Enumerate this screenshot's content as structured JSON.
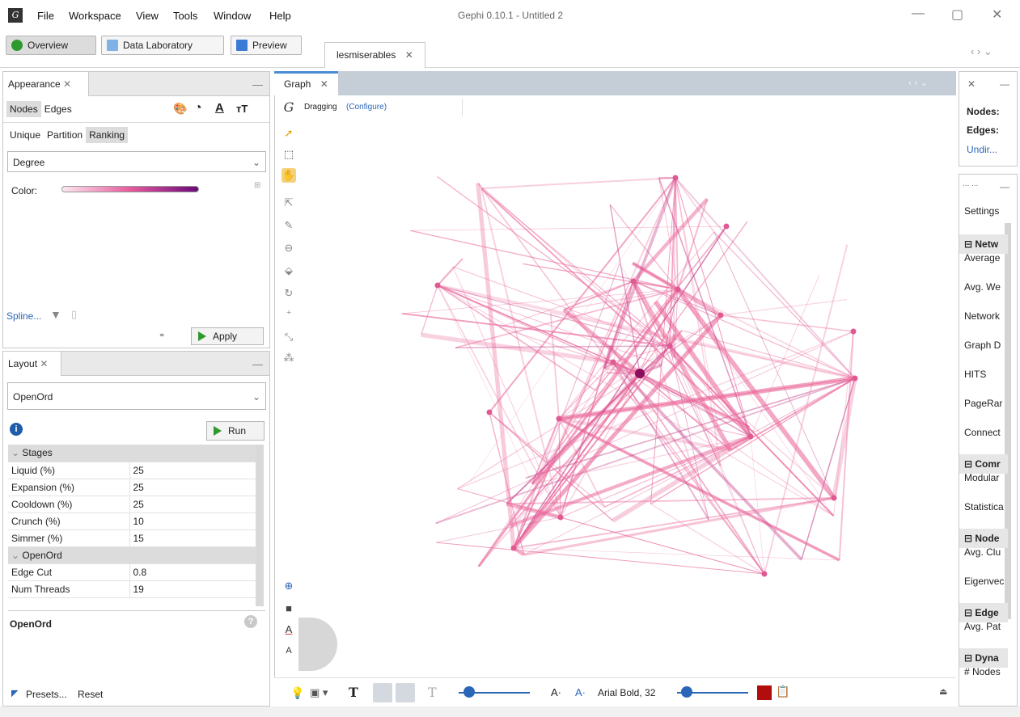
{
  "window": {
    "title": "Gephi 0.10.1 - Untitled 2"
  },
  "menu": [
    "File",
    "Workspace",
    "View",
    "Tools",
    "Window",
    "Help"
  ],
  "perspectives": {
    "overview": "Overview",
    "data_lab": "Data Laboratory",
    "preview": "Preview"
  },
  "workspace_tab": "lesmiserables",
  "appearance": {
    "tab": "Appearance",
    "element_tabs": [
      "Nodes",
      "Edges"
    ],
    "mode_tabs": [
      "Unique",
      "Partition",
      "Ranking"
    ],
    "attribute": "Degree",
    "color_label": "Color:",
    "spline_label": "Spline...",
    "apply_label": "Apply"
  },
  "layout": {
    "tab": "Layout",
    "algorithm": "OpenOrd",
    "run_label": "Run",
    "groups": [
      {
        "name": "Stages",
        "rows": [
          {
            "k": "Liquid (%)",
            "v": "25"
          },
          {
            "k": "Expansion (%)",
            "v": "25"
          },
          {
            "k": "Cooldown (%)",
            "v": "25"
          },
          {
            "k": "Crunch (%)",
            "v": "10"
          },
          {
            "k": "Simmer (%)",
            "v": "15"
          }
        ]
      },
      {
        "name": "OpenOrd",
        "rows": [
          {
            "k": "Edge Cut",
            "v": "0.8"
          },
          {
            "k": "Num Threads",
            "v": "19"
          }
        ]
      }
    ],
    "description_title": "OpenOrd",
    "presets_label": "Presets...",
    "reset_label": "Reset"
  },
  "graph": {
    "tab": "Graph",
    "mode": "Dragging",
    "configure": "(Configure)",
    "font_label": "Arial Bold, 32"
  },
  "context": {
    "nodes": "Nodes:",
    "edges": "Edges:",
    "type": "Undir..."
  },
  "statistics": {
    "settings": "Settings",
    "sections": [
      {
        "name": "Netw",
        "items": [
          "Average",
          "Avg. We",
          "Network",
          "Graph D",
          "HITS",
          "PageRar",
          "Connect"
        ]
      },
      {
        "name": "Comr",
        "items": [
          "Modular",
          "Statistica"
        ]
      },
      {
        "name": "Node",
        "items": [
          "Avg. Clu",
          "Eigenvec"
        ]
      },
      {
        "name": "Edge",
        "items": [
          "Avg. Pat"
        ]
      },
      {
        "name": "Dyna",
        "items": [
          "# Nodes"
        ]
      }
    ]
  },
  "colors": {
    "ranking_light": "#f7d6e3",
    "ranking_dark": "#7a0a72",
    "edge": "#ea6a9c",
    "accent_tab": "#4a8bd6"
  }
}
